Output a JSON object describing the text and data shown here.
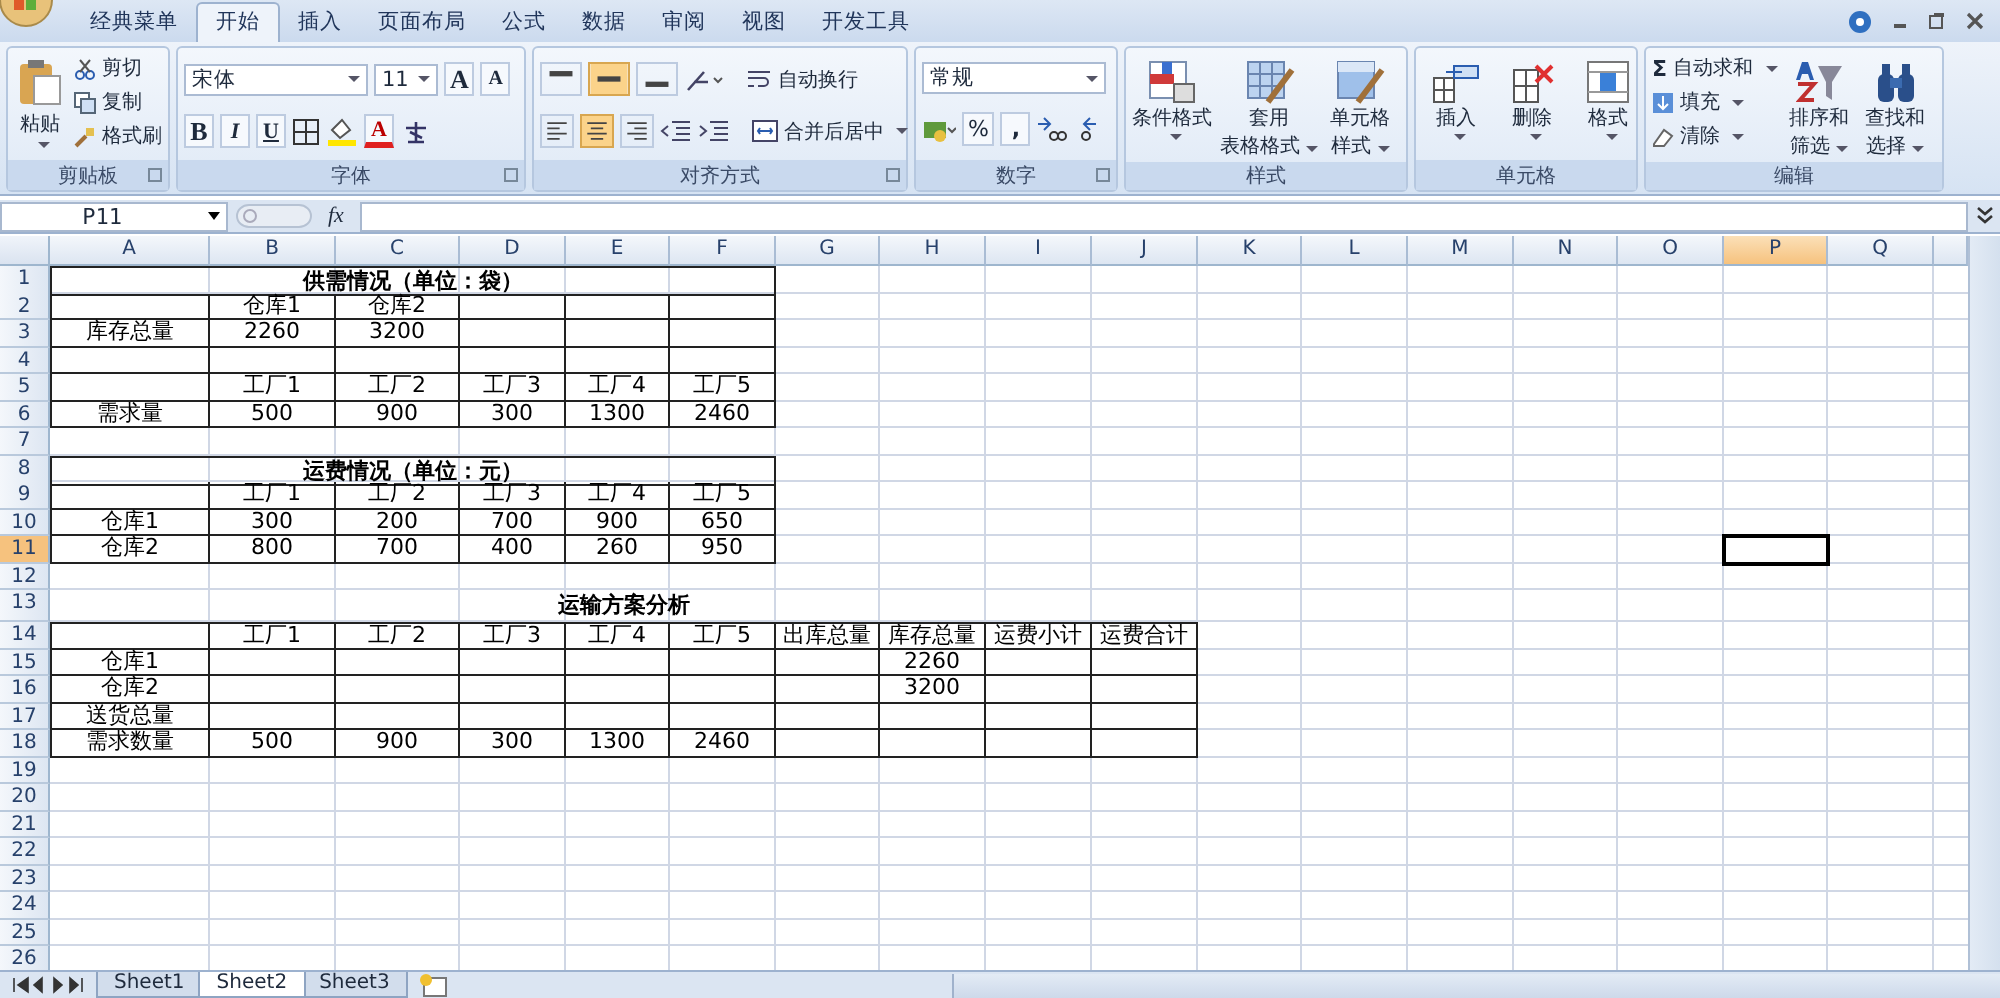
{
  "menu_tabs": [
    {
      "label": "经典菜单",
      "selected": false
    },
    {
      "label": "开始",
      "selected": true
    },
    {
      "label": "插入",
      "selected": false
    },
    {
      "label": "页面布局",
      "selected": false
    },
    {
      "label": "公式",
      "selected": false
    },
    {
      "label": "数据",
      "selected": false
    },
    {
      "label": "审阅",
      "selected": false
    },
    {
      "label": "视图",
      "selected": false
    },
    {
      "label": "开发工具",
      "selected": false
    }
  ],
  "ribbon": {
    "clipboard": {
      "label": "剪贴板",
      "paste": "粘贴",
      "cut": "剪切",
      "copy": "复制",
      "format_painter": "格式刷"
    },
    "font": {
      "label": "字体",
      "font_name": "宋体",
      "font_size": "11",
      "grow": "A",
      "shrink": "A",
      "bold": "B",
      "italic": "I",
      "underline": "U",
      "font_color": "A"
    },
    "alignment": {
      "label": "对齐方式",
      "vertical": [
        {
          "kind": "top",
          "selected": false
        },
        {
          "kind": "middle",
          "selected": true
        },
        {
          "kind": "bottom",
          "selected": false
        }
      ],
      "horizontal": [
        {
          "kind": "left",
          "selected": false
        },
        {
          "kind": "center",
          "selected": true
        },
        {
          "kind": "right",
          "selected": false
        }
      ],
      "wrap_text": "自动换行",
      "merge_center": "合并后居中"
    },
    "number": {
      "label": "数字",
      "format": "常规",
      "percent": "%",
      "comma": ","
    },
    "styles": {
      "label": "样式",
      "buttons": [
        {
          "kind": "conditional",
          "lines": [
            "条件格式"
          ]
        },
        {
          "kind": "table",
          "lines": [
            "套用",
            "表格格式"
          ]
        },
        {
          "kind": "cell",
          "lines": [
            "单元格",
            "样式"
          ]
        }
      ]
    },
    "cells": {
      "label": "单元格",
      "buttons": [
        {
          "kind": "insert",
          "lines": [
            "插入"
          ]
        },
        {
          "kind": "delete",
          "lines": [
            "删除"
          ]
        },
        {
          "kind": "format",
          "lines": [
            "格式"
          ]
        }
      ]
    },
    "editing": {
      "label": "编辑",
      "sum_symbol": "Σ",
      "autosum": "自动求和",
      "fill": "填充",
      "clear": "清除",
      "buttons": [
        {
          "kind": "sort",
          "lines": [
            "排序和",
            "筛选"
          ]
        },
        {
          "kind": "find",
          "lines": [
            "查找和",
            "选择"
          ]
        }
      ]
    }
  },
  "formula_bar": {
    "name_box": "P11",
    "function_label": "fx"
  },
  "sheet": {
    "columns": [
      {
        "letter": "A",
        "selected": false
      },
      {
        "letter": "B",
        "selected": false
      },
      {
        "letter": "C",
        "selected": false
      },
      {
        "letter": "D",
        "selected": false
      },
      {
        "letter": "E",
        "selected": false
      },
      {
        "letter": "F",
        "selected": false
      },
      {
        "letter": "G",
        "selected": false
      },
      {
        "letter": "H",
        "selected": false
      },
      {
        "letter": "I",
        "selected": false
      },
      {
        "letter": "J",
        "selected": false
      },
      {
        "letter": "K",
        "selected": false
      },
      {
        "letter": "L",
        "selected": false
      },
      {
        "letter": "M",
        "selected": false
      },
      {
        "letter": "N",
        "selected": false
      },
      {
        "letter": "O",
        "selected": false
      },
      {
        "letter": "P",
        "selected": true
      },
      {
        "letter": "Q",
        "selected": false
      }
    ],
    "rows": [
      {
        "number": "1",
        "selected": false,
        "kind": "title",
        "boxed": true,
        "cells": [
          "供需情况（单位：袋）"
        ]
      },
      {
        "number": "2",
        "selected": false,
        "kind": "grid",
        "cells": [
          null,
          "仓库1",
          "仓库2",
          null,
          null,
          null
        ]
      },
      {
        "number": "3",
        "selected": false,
        "kind": "grid",
        "cells": [
          "库存总量",
          "2260",
          "3200",
          null,
          null,
          null
        ]
      },
      {
        "number": "4",
        "selected": false,
        "kind": "grid",
        "cells": [
          null,
          null,
          null,
          null,
          null,
          null
        ]
      },
      {
        "number": "5",
        "selected": false,
        "kind": "grid",
        "cells": [
          null,
          "工厂1",
          "工厂2",
          "工厂3",
          "工厂4",
          "工厂5"
        ]
      },
      {
        "number": "6",
        "selected": false,
        "kind": "grid",
        "cells": [
          "需求量",
          "500",
          "900",
          "300",
          "1300",
          "2460"
        ]
      },
      {
        "number": "7",
        "selected": false,
        "kind": "blank"
      },
      {
        "number": "8",
        "selected": false,
        "kind": "title",
        "boxed": true,
        "cells": [
          "运费情况（单位：元）"
        ]
      },
      {
        "number": "9",
        "selected": false,
        "kind": "grid",
        "cells": [
          null,
          "工厂1",
          "工厂2",
          "工厂3",
          "工厂4",
          "工厂5"
        ]
      },
      {
        "number": "10",
        "selected": false,
        "kind": "grid",
        "cells": [
          "仓库1",
          "300",
          "200",
          "700",
          "900",
          "650"
        ]
      },
      {
        "number": "11",
        "selected": true,
        "kind": "grid",
        "cells": [
          "仓库2",
          "800",
          "700",
          "400",
          "260",
          "950"
        ]
      },
      {
        "number": "12",
        "selected": false,
        "kind": "blank"
      },
      {
        "number": "13",
        "selected": false,
        "kind": "title",
        "boxed": false,
        "cells": [
          "运输方案分析"
        ]
      },
      {
        "number": "14",
        "selected": false,
        "kind": "grid",
        "cells": [
          null,
          "工厂1",
          "工厂2",
          "工厂3",
          "工厂4",
          "工厂5",
          "出库总量",
          "库存总量",
          "运费小计",
          "运费合计"
        ]
      },
      {
        "number": "15",
        "selected": false,
        "kind": "grid",
        "cells": [
          "仓库1",
          null,
          null,
          null,
          null,
          null,
          null,
          "2260",
          null,
          null
        ]
      },
      {
        "number": "16",
        "selected": false,
        "kind": "grid",
        "cells": [
          "仓库2",
          null,
          null,
          null,
          null,
          null,
          null,
          "3200",
          null,
          null
        ]
      },
      {
        "number": "17",
        "selected": false,
        "kind": "grid",
        "cells": [
          "送货总量",
          null,
          null,
          null,
          null,
          null,
          null,
          null,
          null,
          null
        ]
      },
      {
        "number": "18",
        "selected": false,
        "kind": "grid",
        "cells": [
          "需求数量",
          "500",
          "900",
          "300",
          "1300",
          "2460",
          null,
          null,
          null,
          null
        ]
      },
      {
        "number": "19",
        "selected": false,
        "kind": "blank"
      },
      {
        "number": "20",
        "selected": false,
        "kind": "blank"
      },
      {
        "number": "21",
        "selected": false,
        "kind": "blank"
      },
      {
        "number": "22",
        "selected": false,
        "kind": "blank"
      },
      {
        "number": "23",
        "selected": false,
        "kind": "blank"
      },
      {
        "number": "24",
        "selected": false,
        "kind": "blank"
      },
      {
        "number": "25",
        "selected": false,
        "kind": "blank"
      },
      {
        "number": "26",
        "selected": false,
        "kind": "blank"
      }
    ]
  },
  "sheet_tabs": [
    {
      "label": "Sheet1",
      "selected": false
    },
    {
      "label": "Sheet2",
      "selected": true
    },
    {
      "label": "Sheet3",
      "selected": false
    }
  ]
}
